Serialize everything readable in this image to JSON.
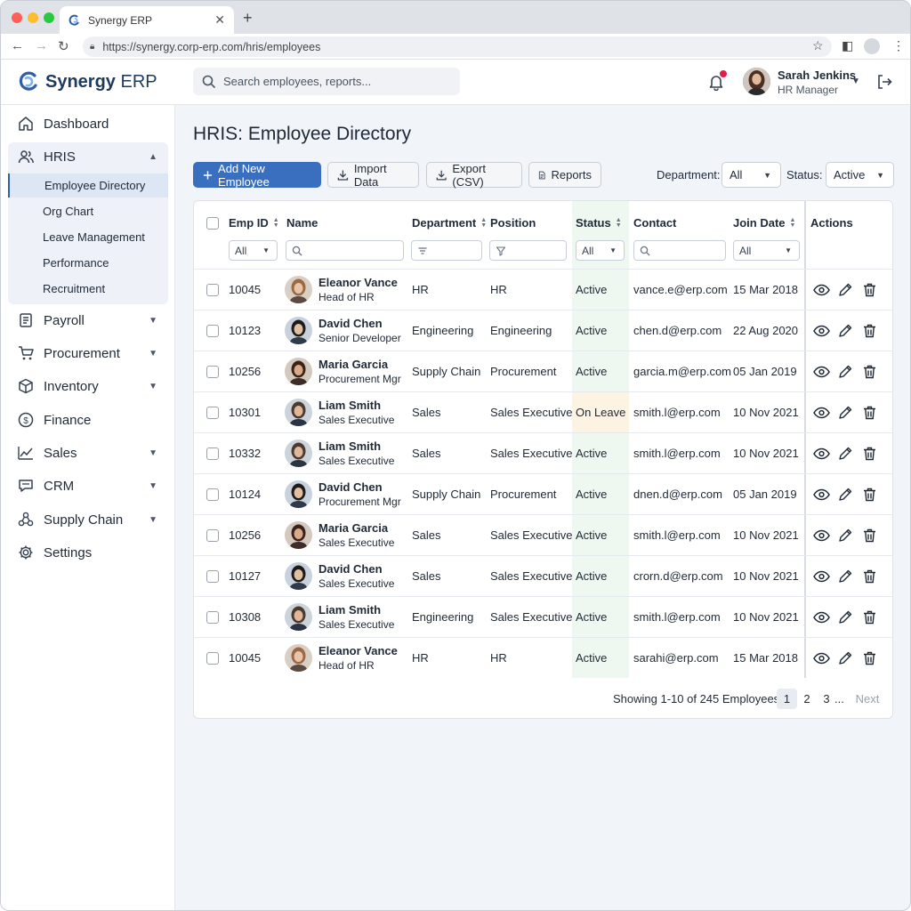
{
  "browser": {
    "tab_title": "Synergy ERP",
    "url": "https://synergy.corp-erp.com/hris/employees"
  },
  "header": {
    "brand_bold": "Synergy",
    "brand_rest": " ERP",
    "search_placeholder": "Search employees, reports...",
    "user_name": "Sarah Jenkins",
    "user_role": "HR Manager"
  },
  "sidebar": {
    "items": [
      {
        "label": "Dashboard",
        "icon": "home-icon"
      },
      {
        "label": "HRIS",
        "icon": "users-icon",
        "expanded": true
      },
      {
        "label": "Payroll",
        "icon": "payroll-icon"
      },
      {
        "label": "Procurement",
        "icon": "cart-icon"
      },
      {
        "label": "Inventory",
        "icon": "box-icon"
      },
      {
        "label": "Finance",
        "icon": "dollar-icon"
      },
      {
        "label": "Sales",
        "icon": "trend-icon"
      },
      {
        "label": "CRM",
        "icon": "chat-icon"
      },
      {
        "label": "Supply Chain",
        "icon": "network-icon"
      },
      {
        "label": "Settings",
        "icon": "gear-icon"
      }
    ],
    "hris_sub": [
      "Employee Directory",
      "Org Chart",
      "Leave Management",
      "Performance",
      "Recruitment"
    ]
  },
  "page": {
    "title": "HRIS: Employee Directory",
    "buttons": {
      "add": "Add New Employee",
      "import": "Import Data",
      "export": "Export (CSV)",
      "reports": "Reports"
    },
    "filters": {
      "department_label": "Department:",
      "department_value": "All",
      "status_label": "Status:",
      "status_value": "Active"
    }
  },
  "table": {
    "columns": [
      "Emp ID",
      "Name",
      "Department",
      "Position",
      "Status",
      "Contact",
      "Join Date",
      "Actions"
    ],
    "filters": {
      "emp_id": "All",
      "status": "All",
      "join_date": "All"
    },
    "rows": [
      {
        "id": "10045",
        "name": "Eleanor Vance",
        "title": "Head of HR",
        "dept": "HR",
        "position": "HR",
        "status": "Active",
        "contact": "vance.e@erp.com",
        "joined": "15 Mar 2018"
      },
      {
        "id": "10123",
        "name": "David Chen",
        "title": "Senior Developer",
        "dept": "Engineering",
        "position": "Engineering",
        "status": "Active",
        "contact": "chen.d@erp.com",
        "joined": "22 Aug 2020"
      },
      {
        "id": "10256",
        "name": "Maria Garcia",
        "title": "Procurement Mgr",
        "dept": "Supply Chain",
        "position": "Procurement",
        "status": "Active",
        "contact": "garcia.m@erp.com",
        "joined": "05 Jan 2019"
      },
      {
        "id": "10301",
        "name": "Liam Smith",
        "title": "Sales Executive",
        "dept": "Sales",
        "position": "Sales Executive",
        "status": "On Leave",
        "contact": "smith.l@erp.com",
        "joined": "10 Nov 2021"
      },
      {
        "id": "10332",
        "name": "Liam Smith",
        "title": "Sales Executive",
        "dept": "Sales",
        "position": "Sales Executive",
        "status": "Active",
        "contact": "smith.l@erp.com",
        "joined": "10 Nov 2021"
      },
      {
        "id": "10124",
        "name": "David Chen",
        "title": "Procurement Mgr",
        "dept": "Supply Chain",
        "position": "Procurement",
        "status": "Active",
        "contact": "dnen.d@erp.com",
        "joined": "05 Jan 2019"
      },
      {
        "id": "10256",
        "name": "Maria Garcia",
        "title": "Sales Executive",
        "dept": "Sales",
        "position": "Sales Executive",
        "status": "Active",
        "contact": "smith.l@erp.com",
        "joined": "10 Nov 2021"
      },
      {
        "id": "10127",
        "name": "David Chen",
        "title": "Sales Executive",
        "dept": "Sales",
        "position": "Sales Executive",
        "status": "Active",
        "contact": "crorn.d@erp.com",
        "joined": "10 Nov 2021"
      },
      {
        "id": "10308",
        "name": "Liam Smith",
        "title": "Sales Executive",
        "dept": "Engineering",
        "position": "Sales Executive",
        "status": "Active",
        "contact": "smith.l@erp.com",
        "joined": "10 Nov 2021"
      },
      {
        "id": "10045",
        "name": "Eleanor Vance",
        "title": "Head of HR",
        "dept": "HR",
        "position": "HR",
        "status": "Active",
        "contact": "sarahi@erp.com",
        "joined": "15 Mar 2018"
      }
    ]
  },
  "pagination": {
    "summary": "Showing 1-10 of 245 Employees.",
    "pages": [
      "1",
      "2",
      "3"
    ],
    "ellipsis": "...",
    "next": "Next"
  },
  "colors": {
    "primary": "#3a6fbf",
    "active_bg": "#e6f6e9",
    "leave_bg": "#fdf3e3",
    "notification": "#e11d48"
  }
}
